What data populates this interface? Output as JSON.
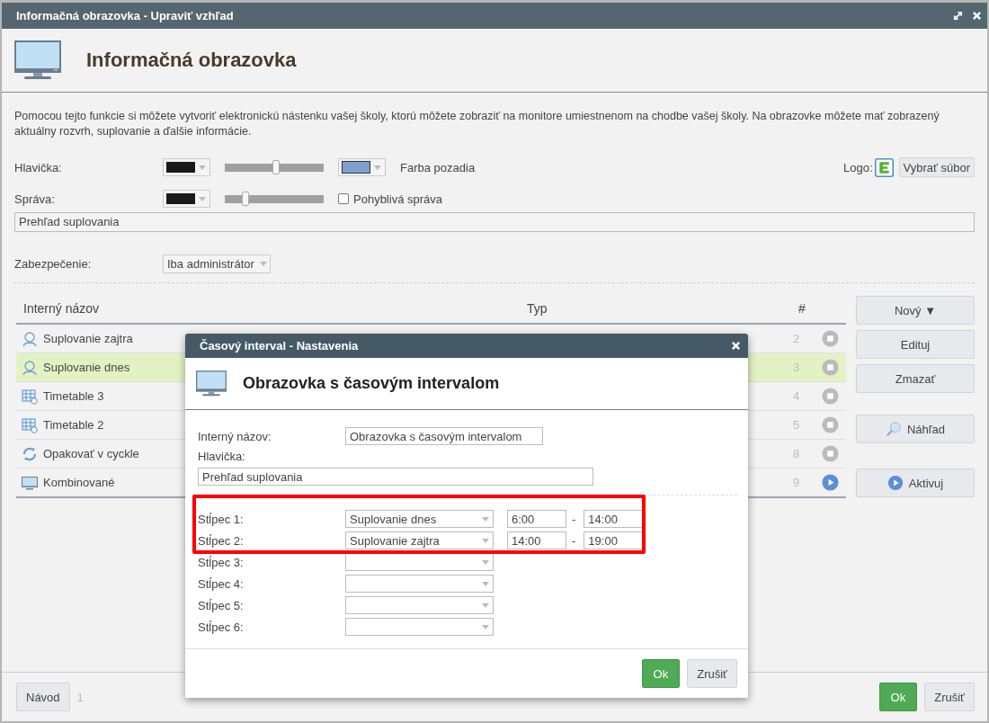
{
  "window": {
    "title": "Informačná obrazovka - Upraviť vzhľad"
  },
  "header": {
    "title": "Informačná obrazovka"
  },
  "description": "Pomocou tejto funkcie si môžete vytvoriť elektronickú nástenku vašej školy, ktorú môžete zobraziť na monitore umiestnenom na chodbe vašej školy. Na obrazovke môžete mať zobrazený aktuálny rozvrh, suplovanie a ďalšie informácie.",
  "settings": {
    "header_label": "Hlavička:",
    "header_slider": {
      "level": 0.53
    },
    "background_label": "Farba pozadia",
    "logo_label": "Logo:",
    "logo_button": "Vybrať súbor",
    "message_label": "Správa:",
    "message_slider": {
      "level": 0.22
    },
    "moving_message": {
      "label": "Pohyblivá správa",
      "checked": false
    },
    "message_value": "Prehľad suplovania",
    "security_label": "Zabezpečenie:",
    "security_value": "Iba administrátor"
  },
  "table": {
    "columns": [
      "Interný názov",
      "Typ",
      "#"
    ],
    "rows": [
      {
        "name": "Suplovanie zajtra",
        "kind": "people",
        "number": "2",
        "active": false,
        "selected": false
      },
      {
        "name": "Suplovanie dnes",
        "kind": "people",
        "number": "3",
        "active": false,
        "selected": true
      },
      {
        "name": "Timetable 3",
        "kind": "grid",
        "number": "4",
        "active": false,
        "selected": false
      },
      {
        "name": "Timetable 2",
        "kind": "grid",
        "number": "5",
        "active": false,
        "selected": false
      },
      {
        "name": "Opakovať v cyckle",
        "kind": "cycle",
        "number": "8",
        "active": false,
        "selected": false
      },
      {
        "name": "Kombinované",
        "kind": "monitor",
        "number": "9",
        "active": true,
        "selected": false
      }
    ]
  },
  "side_buttons": [
    {
      "label": "Nový",
      "caret": "▼",
      "kind": "plain"
    },
    {
      "label": "Edituj",
      "kind": "plain"
    },
    {
      "label": "Zmazať",
      "kind": "plain"
    },
    {
      "label": "Náhľad",
      "kind": "preview"
    },
    {
      "label": "Aktivuj",
      "kind": "activate"
    }
  ],
  "footer": {
    "help_button": "Návod",
    "page": "1",
    "ok_button": "Ok",
    "cancel_button": "Zrušiť"
  },
  "dialog": {
    "title": "Časový interval - Nastavenia",
    "heading": "Obrazovka s časovým intervalom",
    "name_label": "Interný názov:",
    "name_value": "Obrazovka s časovým intervalom",
    "header_label": "Hlavička:",
    "header_value": "Prehľad suplovania",
    "columns": [
      {
        "label": "Stĺpec 1:",
        "value": "Suplovanie dnes",
        "from": "6:00",
        "separator": "-",
        "to": "14:00"
      },
      {
        "label": "Stĺpec 2:",
        "value": "Suplovanie zajtra",
        "from": "14:00",
        "separator": "-",
        "to": "19:00"
      },
      {
        "label": "Stĺpec 3:"
      },
      {
        "label": "Stĺpec 4:"
      },
      {
        "label": "Stĺpec 5:"
      },
      {
        "label": "Stĺpec 6:"
      }
    ],
    "ok_button": "Ok",
    "cancel_button": "Zrušiť"
  }
}
